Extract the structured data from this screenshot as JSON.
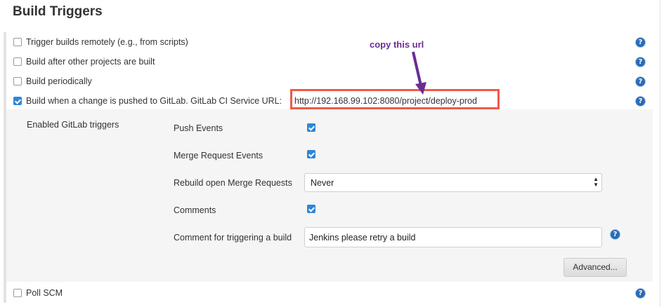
{
  "section": {
    "title": "Build Triggers"
  },
  "triggers": [
    {
      "label": "Trigger builds remotely (e.g., from scripts)",
      "checked": false
    },
    {
      "label": "Build after other projects are built",
      "checked": false
    },
    {
      "label": "Build periodically",
      "checked": false
    },
    {
      "label": "Build when a change is pushed to GitLab. GitLab CI Service URL:",
      "checked": true,
      "url": "http://192.168.99.102:8080/project/deploy-prod"
    },
    {
      "label": "Poll SCM",
      "checked": false
    }
  ],
  "annotation": {
    "text": "copy this url"
  },
  "gitlab": {
    "enabled_label": "Enabled GitLab triggers",
    "push_events": {
      "label": "Push Events",
      "checked": true
    },
    "merge_request_events": {
      "label": "Merge Request Events",
      "checked": true
    },
    "rebuild_open_mr": {
      "label": "Rebuild open Merge Requests",
      "value": "Never"
    },
    "comments": {
      "label": "Comments",
      "checked": true
    },
    "comment_trigger": {
      "label": "Comment for triggering a build",
      "value": "Jenkins please retry a build"
    },
    "advanced_button": "Advanced..."
  },
  "icons": {
    "help": "help-icon",
    "checkbox": "checkbox"
  },
  "help_glyph": "?",
  "colors": {
    "accent": "#2e86d6",
    "annotation": "#6a2d95",
    "highlight": "#ef5a47",
    "help": "#2b6bb5"
  }
}
